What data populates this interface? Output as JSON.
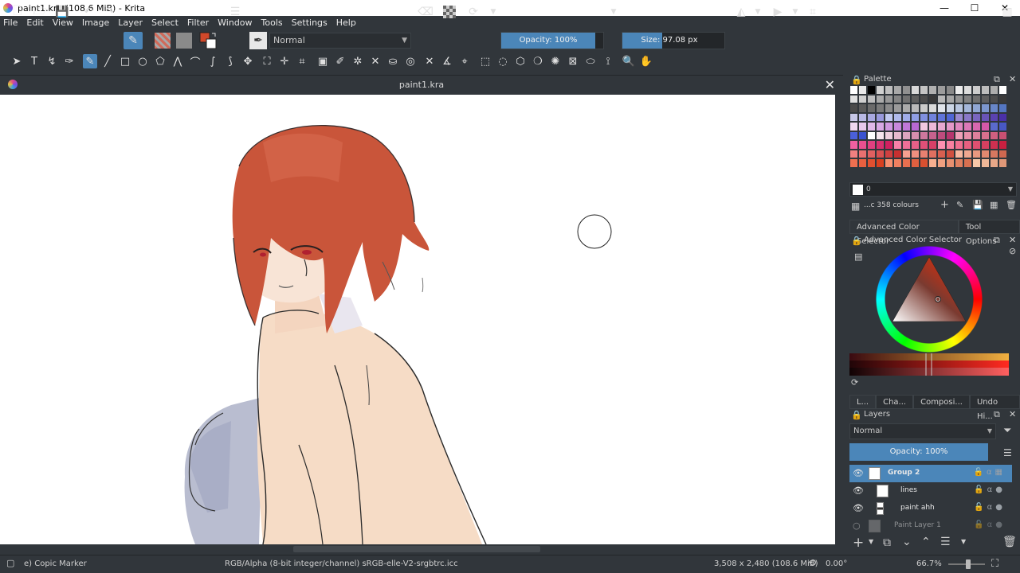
{
  "window": {
    "title": "paint1.kra (108.6 MiB) - Krita",
    "minimize": "—",
    "maximize": "☐",
    "close": "✕"
  },
  "menu": [
    "File",
    "Edit",
    "View",
    "Image",
    "Layer",
    "Select",
    "Filter",
    "Window",
    "Tools",
    "Settings",
    "Help"
  ],
  "toolbar": {
    "blend_mode": "Normal",
    "opacity_label": "Opacity: 100%",
    "opacity_value": 100,
    "size_label": "Size: 97.08 px",
    "size_fraction": 0.42
  },
  "document": {
    "tab_title": "paint1.kra",
    "close": "✕"
  },
  "palette": {
    "title": "Palette",
    "current_index": "0",
    "colours_label": "...c 358 colours",
    "swatches": [
      "#ffffff",
      "#e8e8e8",
      "#000000",
      "#d0d0d0",
      "#bfbfbf",
      "#a8a8a8",
      "#909090",
      "#d8d8d8",
      "#c4c4c4",
      "#b0b0b0",
      "#9c9c9c",
      "#888888",
      "#ececec",
      "#dcdcdc",
      "#cccccc",
      "#bcbcbc",
      "#acacac",
      "#ffffff",
      "#e0e0e0",
      "#cfcfcf",
      "#bdbdbd",
      "#aaaaaa",
      "#979797",
      "#848484",
      "#717171",
      "#5e5e5e",
      "#4b4b4b",
      "#383838",
      "#b8b8b8",
      "#a6a6a6",
      "#949494",
      "#828282",
      "#707070",
      "#5e5e5e",
      "#4c4c4c",
      "#3a3a3a",
      "#4a4a4a",
      "#5a5a5a",
      "#6a6a6a",
      "#7a7a7a",
      "#8a8a8a",
      "#9a9a9a",
      "#aaaaaa",
      "#bababa",
      "#cacaca",
      "#dadada",
      "#e0e4ea",
      "#ccd6e6",
      "#b8c6e0",
      "#a4b6da",
      "#90a6d4",
      "#7c96ce",
      "#6886c8",
      "#5476c2",
      "#c8c8e8",
      "#b8b8e4",
      "#a8a8e0",
      "#9898dc",
      "#c0c8f0",
      "#b0baec",
      "#a0acE8",
      "#909ee4",
      "#8090e0",
      "#7082dc",
      "#6074d8",
      "#5066d4",
      "#9a8ad0",
      "#8a78c8",
      "#7a66c0",
      "#6a54b8",
      "#5a42b0",
      "#4a30a8",
      "#f0d8f0",
      "#e8c8ec",
      "#e0b8e8",
      "#d8a8e4",
      "#d098e0",
      "#c888dc",
      "#c078d8",
      "#b868d4",
      "#f0c8e0",
      "#ecb8d8",
      "#e8a8d0",
      "#e498c8",
      "#e088c0",
      "#dc78b8",
      "#d868b0",
      "#d458a8",
      "#5a6acc",
      "#4858c4",
      "#4a60d8",
      "#3a52d0",
      "#ffffff",
      "#f6e6ee",
      "#eed0de",
      "#e6bace",
      "#dea4be",
      "#d68eae",
      "#ce789e",
      "#c6628e",
      "#be4c7e",
      "#b6366e",
      "#f0a0b8",
      "#e890aa",
      "#e0809c",
      "#d8708e",
      "#d06080",
      "#c85072",
      "#f060a0",
      "#e85090",
      "#e04080",
      "#d83070",
      "#d02060",
      "#f880a8",
      "#f07098",
      "#e86088",
      "#e05078",
      "#d84068",
      "#ff90b0",
      "#f880a0",
      "#f07090",
      "#e86080",
      "#e05070",
      "#d84060",
      "#d03050",
      "#c82040",
      "#f08080",
      "#e87070",
      "#e06060",
      "#d85050",
      "#d04040",
      "#c83030",
      "#f8a090",
      "#f09080",
      "#e88070",
      "#e07060",
      "#d86050",
      "#d05040",
      "#f8b8a0",
      "#f0a890",
      "#e89880",
      "#e08870",
      "#d87860",
      "#d06850",
      "#f07050",
      "#e86040",
      "#e05030",
      "#d84020",
      "#f89070",
      "#f08060",
      "#e87050",
      "#e06040",
      "#d85030",
      "#f8b090",
      "#f0a080",
      "#e89070",
      "#e08060",
      "#d87050",
      "#f8c8a8",
      "#f0b898",
      "#e8a888",
      "#e09878"
    ]
  },
  "tabs_color": {
    "advanced": "Advanced Color Selector",
    "tool_options": "Tool Options"
  },
  "color_selector": {
    "title": "Advanced Color Selector",
    "current_color": "#d1482a"
  },
  "tabs_layers": [
    "L...",
    "Cha...",
    "Composi...",
    "Undo Hi..."
  ],
  "layers": {
    "title": "Layers",
    "blend_mode": "Normal",
    "opacity_label": "Opacity:  100%",
    "items": [
      {
        "name": "Group 2",
        "selected": true,
        "visible": true
      },
      {
        "name": "lines",
        "selected": false,
        "visible": true
      },
      {
        "name": "paint ahh",
        "selected": false,
        "visible": true
      },
      {
        "name": "Paint Layer 1",
        "selected": false,
        "visible": false
      }
    ]
  },
  "status": {
    "brush": "e) Copic Marker",
    "colorspace": "RGB/Alpha (8-bit integer/channel)  sRGB-elle-V2-srgbtrc.icc",
    "dimensions": "3,508 x 2,480 (108.6 MiB)",
    "rotation": "0.00°",
    "zoom": "66.7%"
  },
  "colors": {
    "accent": "#4b86b9",
    "panel": "#31363b",
    "hair": "#c9553a",
    "skin": "#f6dcc6",
    "dress": "#b8bccf"
  }
}
